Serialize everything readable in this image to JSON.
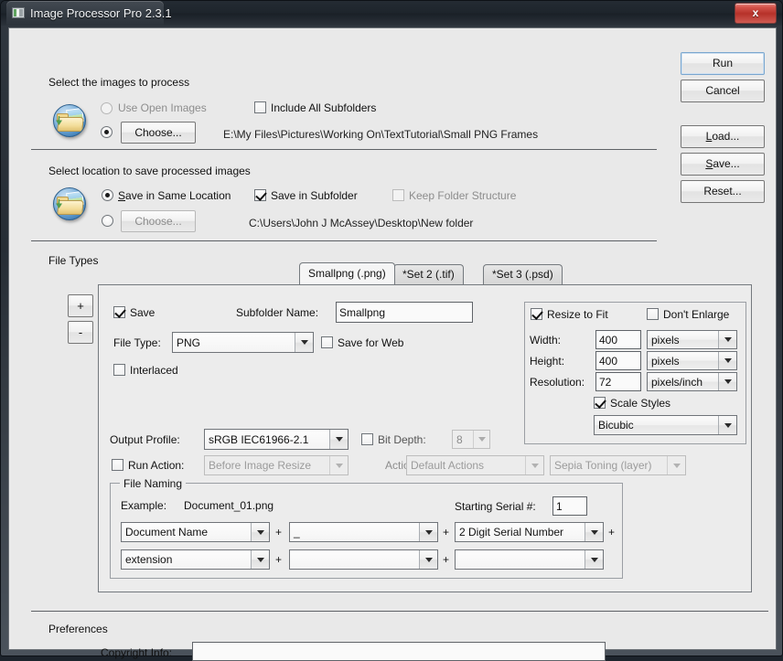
{
  "window": {
    "title": "Image Processor Pro 2.3.1",
    "close_label": "x",
    "app_icon": "app-icon"
  },
  "section_images": {
    "heading": "Select the images to process",
    "use_open_images_label": "Use Open Images",
    "choose_label": "Choose...",
    "include_subfolders_label": "Include All Subfolders",
    "source_path": "E:\\My Files\\Pictures\\Working On\\TextTutorial\\Small PNG Frames",
    "folder_icon": "open-folder-image-icon"
  },
  "section_save": {
    "heading": "Select location to save processed images",
    "save_same_location_label": "Save in Same Location",
    "choose_label": "Choose...",
    "save_in_subfolder_label": "Save in Subfolder",
    "keep_folder_structure_label": "Keep Folder Structure",
    "dest_path": "C:\\Users\\John J McAssey\\Desktop\\New folder",
    "folder_icon": "save-folder-image-icon"
  },
  "side_buttons": {
    "run": "Run",
    "cancel": "Cancel",
    "load": "Load...",
    "save": "Save...",
    "reset": "Reset..."
  },
  "file_types": {
    "heading": "File Types",
    "add_label": "+",
    "remove_label": "-",
    "tabs": [
      {
        "label": "Smallpng (.png)",
        "active": true
      },
      {
        "label": "*Set 2 (.tif)",
        "active": false
      },
      {
        "label": "*Set 3 (.psd)",
        "active": false
      }
    ]
  },
  "panel": {
    "save_checkbox_label": "Save",
    "save_checked": true,
    "subfolder_name_label": "Subfolder Name:",
    "subfolder_name_value": "Smallpng",
    "file_type_label": "File Type:",
    "file_type_value": "PNG",
    "save_for_web_label": "Save for Web",
    "save_for_web_checked": false,
    "interlaced_label": "Interlaced",
    "interlaced_checked": false,
    "output_profile_label": "Output Profile:",
    "output_profile_value": "sRGB IEC61966-2.1",
    "bit_depth_label": "Bit Depth:",
    "bit_depth_checked": false,
    "bit_depth_value": "8",
    "run_action_label": "Run Action:",
    "run_action_checked": false,
    "run_action_when_value": "Before Image Resize",
    "action_label": "Action:",
    "action_set_value": "Default Actions",
    "action_value": "Sepia Toning (layer)"
  },
  "resize": {
    "resize_to_fit_label": "Resize to Fit",
    "resize_to_fit_checked": true,
    "dont_enlarge_label": "Don't Enlarge",
    "dont_enlarge_checked": false,
    "width_label": "Width:",
    "width_value": "400",
    "width_unit": "pixels",
    "height_label": "Height:",
    "height_value": "400",
    "height_unit": "pixels",
    "resolution_label": "Resolution:",
    "resolution_value": "72",
    "resolution_unit": "pixels/inch",
    "scale_styles_label": "Scale Styles",
    "scale_styles_checked": true,
    "resample_value": "Bicubic"
  },
  "file_naming": {
    "group_title": "File Naming",
    "example_label": "Example:",
    "example_value": "Document_01.png",
    "starting_serial_label": "Starting Serial #:",
    "starting_serial_value": "1",
    "plus": "+",
    "row1": {
      "f1": "Document Name",
      "f2": "_",
      "f3": "2 Digit Serial Number"
    },
    "row2": {
      "f1": "extension",
      "f2": "",
      "f3": ""
    }
  },
  "preferences": {
    "heading": "Preferences",
    "copyright_label": "Copyright Info:",
    "copyright_value": ""
  },
  "colors": {
    "accent": "#7aa7cf",
    "close_red": "#b6312a",
    "dialog_bg": "#e9e9e9",
    "panel_bg": "#ececec"
  }
}
